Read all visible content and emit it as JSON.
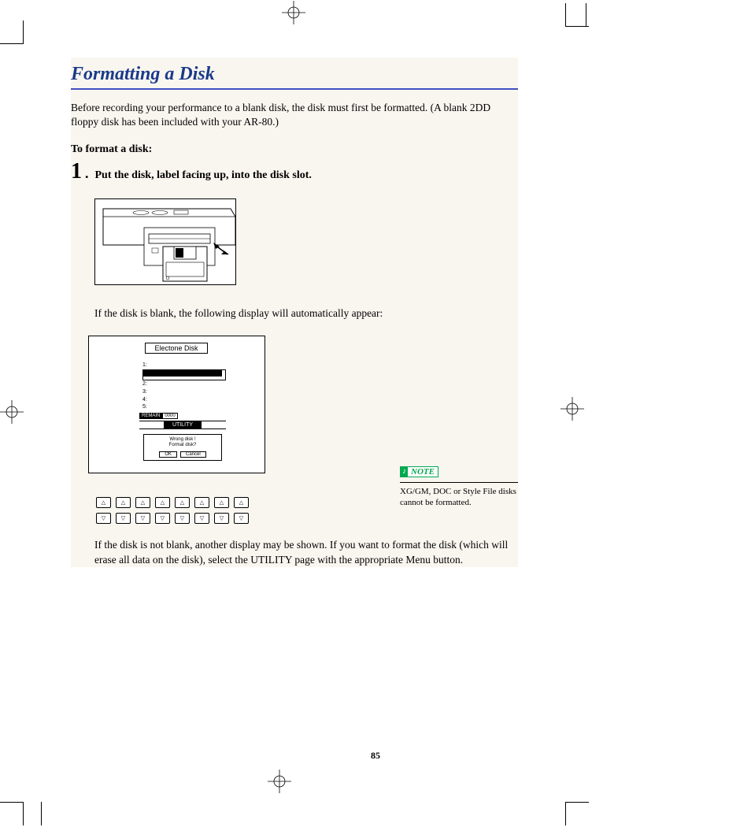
{
  "title": "Formatting a Disk",
  "intro": "Before recording your performance to a blank disk, the disk must first be formatted.  (A blank 2DD floppy disk has been included with your AR-80.)",
  "subhead": "To format a disk:",
  "step1": {
    "num": "1",
    "text": "Put the disk, label facing up, into the disk slot."
  },
  "caption1": "If the disk is blank, the following display will automatically appear:",
  "lcd": {
    "title": "Electone Disk",
    "items": [
      "1:",
      "2:",
      "3:",
      "4:",
      "5:"
    ],
    "remain_label": "REMAIN",
    "remain_value": "0000",
    "utility": "UTILITY",
    "dialog_line1": "Wrong disk !",
    "dialog_line2": "Format disk?",
    "ok": "OK",
    "cancel": "Cancel"
  },
  "note": {
    "badge": "NOTE",
    "text": "XG/GM, DOC or Style File disks cannot be formatted."
  },
  "body2": "If the disk is not blank, another display may be shown.  If you want to format the disk (which will erase all data on the disk), select the UTILITY page with the appropriate Menu button.",
  "page_number": "85"
}
